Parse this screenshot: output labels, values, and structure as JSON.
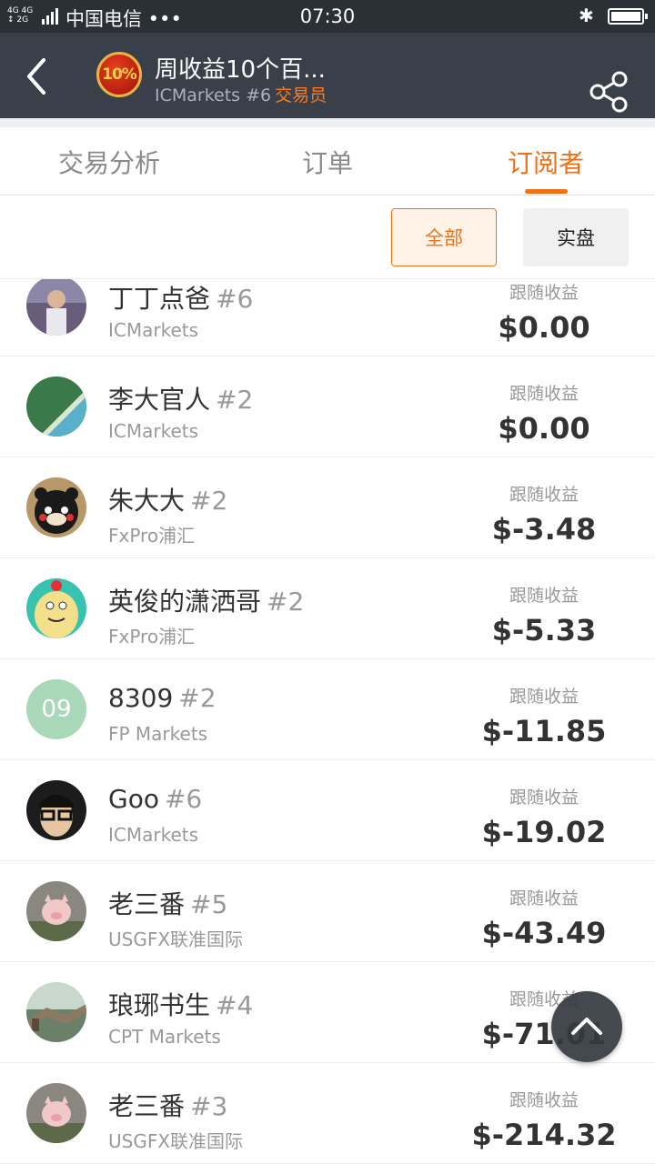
{
  "status_bar": {
    "network": "4G 4G\n2G",
    "carrier": "中国电信 •••",
    "time": "07:30"
  },
  "header": {
    "back_icon": "back-arrow-icon",
    "logo_text": "10%",
    "title": "周收益10个百...",
    "subtitle_broker": "ICMarkets #6",
    "subtitle_role": "交易员",
    "share_icon": "share-icon"
  },
  "tabs": [
    {
      "label": "交易分析",
      "active": false
    },
    {
      "label": "订单",
      "active": false
    },
    {
      "label": "订阅者",
      "active": true
    }
  ],
  "filters": {
    "all": "全部",
    "live": "实盘",
    "selected": "all"
  },
  "subscribers": [
    {
      "name": "丁丁点爸",
      "rank": "#6",
      "broker": "ICMarkets",
      "profit_label": "跟随收益",
      "profit": "$0.00",
      "avatar": "photo-child"
    },
    {
      "name": "李大官人",
      "rank": "#2",
      "broker": "ICMarkets",
      "profit_label": "跟随收益",
      "profit": "$0.00",
      "avatar": "photo-coast"
    },
    {
      "name": "朱大大",
      "rank": "#2",
      "broker": "FxPro浦汇",
      "profit_label": "跟随收益",
      "profit": "$-3.48",
      "avatar": "photo-bear"
    },
    {
      "name": "英俊的潇洒哥",
      "rank": "#2",
      "broker": "FxPro浦汇",
      "profit_label": "跟随收益",
      "profit": "$-5.33",
      "avatar": "cartoon-egg"
    },
    {
      "name": "8309",
      "rank": "#2",
      "broker": "FP Markets",
      "profit_label": "跟随收益",
      "profit": "$-11.85",
      "avatar": "text",
      "avatar_text": "09"
    },
    {
      "name": "Goo",
      "rank": "#6",
      "broker": "ICMarkets",
      "profit_label": "跟随收益",
      "profit": "$-19.02",
      "avatar": "photo-man-glasses"
    },
    {
      "name": "老三番",
      "rank": "#5",
      "broker": "USGFX联准国际",
      "profit_label": "跟随收益",
      "profit": "$-43.49",
      "avatar": "photo-pig"
    },
    {
      "name": "琅琊书生",
      "rank": "#4",
      "broker": "CPT Markets",
      "profit_label": "跟随收益",
      "profit": "$-71.01",
      "avatar": "photo-greatwall"
    },
    {
      "name": "老三番",
      "rank": "#3",
      "broker": "USGFX联准国际",
      "profit_label": "跟随收益",
      "profit": "$-214.32",
      "avatar": "photo-pig"
    }
  ],
  "scroll_top_icon": "chevron-up-icon"
}
